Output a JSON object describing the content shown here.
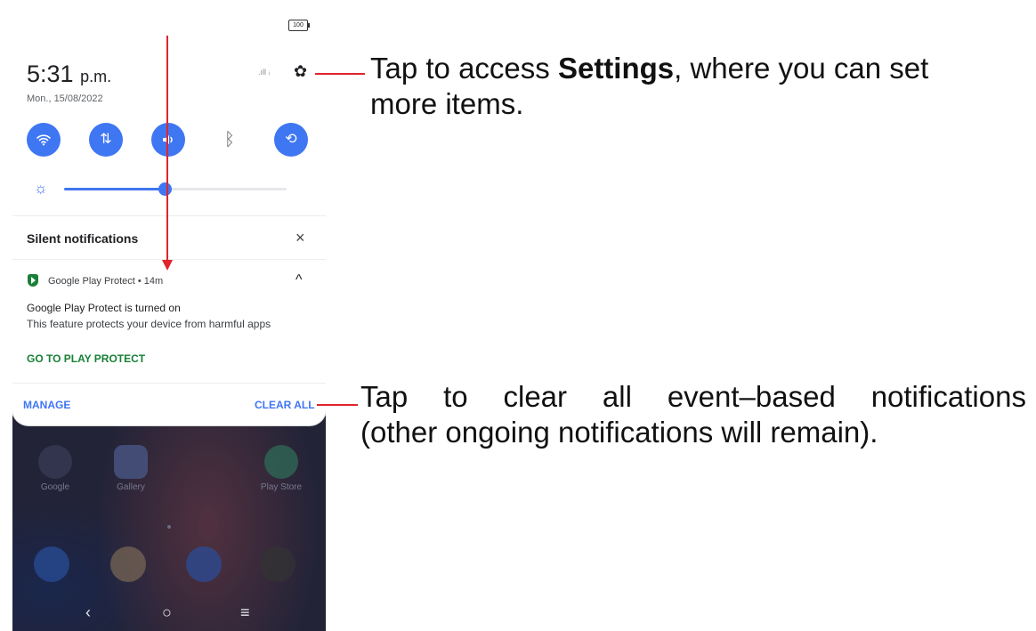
{
  "status_bar": {
    "battery": "100"
  },
  "header": {
    "time": "5:31",
    "ampm": "p.m.",
    "date": "Mon., 15/08/2022"
  },
  "icons": {
    "settings": "gear-icon",
    "wifi": "wifi-icon",
    "data": "mobile-data-icon",
    "sound": "sound-icon",
    "bluetooth": "bluetooth-icon",
    "rotate": "auto-rotate-icon",
    "brightness": "brightness-icon"
  },
  "brightness": {
    "level": 0.45
  },
  "notifications": {
    "section_title": "Silent notifications",
    "item": {
      "app": "Google Play Protect • 14m",
      "title": "Google Play Protect is turned on",
      "body": "This feature protects your device from harmful apps",
      "action": "GO TO PLAY PROTECT"
    },
    "manage_label": "MANAGE",
    "clear_all_label": "CLEAR ALL"
  },
  "home": {
    "apps": [
      {
        "label": "Google"
      },
      {
        "label": "Gallery"
      },
      {
        "label": "Play Store"
      }
    ]
  },
  "callouts": {
    "settings_pre": "Tap to access ",
    "settings_bold": "Settings",
    "settings_post": ", where you can set",
    "settings_line2": "more items.",
    "clear_words": [
      "Tap",
      "to",
      "clear",
      "all",
      "event–based",
      "notifications"
    ],
    "clear_line2": "(other ongoing notifications will remain)."
  },
  "colors": {
    "accent": "#3f76f2",
    "green": "#188038",
    "annotation": "#e0242c"
  }
}
